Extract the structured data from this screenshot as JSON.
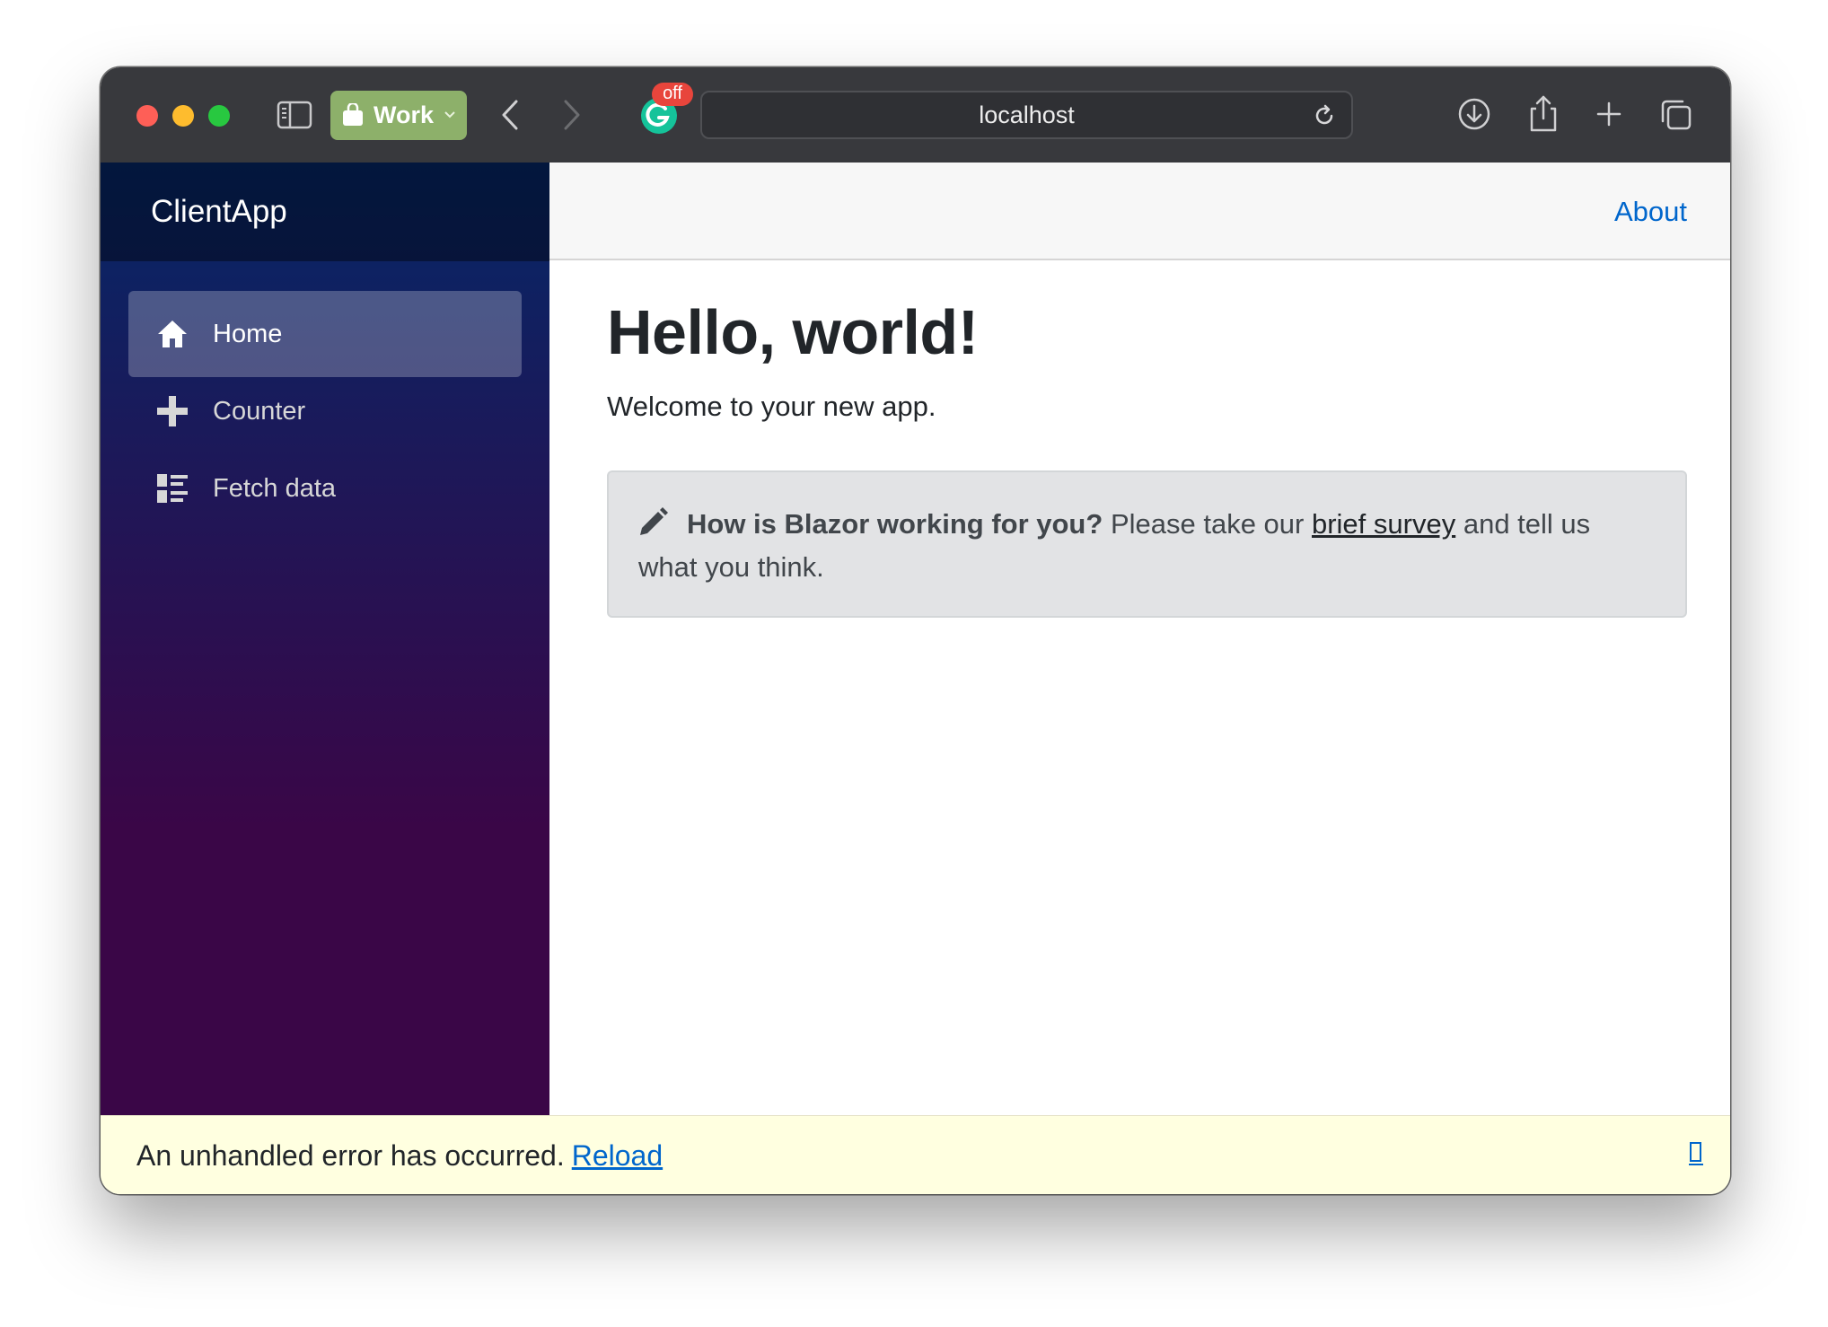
{
  "browser": {
    "tab_group": "Work",
    "grammarly_badge": "off",
    "url": "localhost"
  },
  "sidebar": {
    "brand": "ClientApp",
    "items": [
      {
        "label": "Home",
        "icon": "home-icon",
        "active": true
      },
      {
        "label": "Counter",
        "icon": "plus-icon",
        "active": false
      },
      {
        "label": "Fetch data",
        "icon": "list-icon",
        "active": false
      }
    ]
  },
  "top_row": {
    "about": "About"
  },
  "main": {
    "title": "Hello, world!",
    "welcome": "Welcome to your new app.",
    "survey": {
      "question": "How is Blazor working for you?",
      "prefix": "Please take our",
      "link": "brief survey",
      "suffix": "and tell us what you think."
    }
  },
  "error_bar": {
    "message": "An unhandled error has occurred.",
    "reload": "Reload"
  },
  "colors": {
    "accent_link": "#0066cc",
    "tab_group": "#8db06a",
    "sidebar_top": "#052767",
    "sidebar_bottom": "#3a0647",
    "error_bg": "#ffffe0"
  }
}
